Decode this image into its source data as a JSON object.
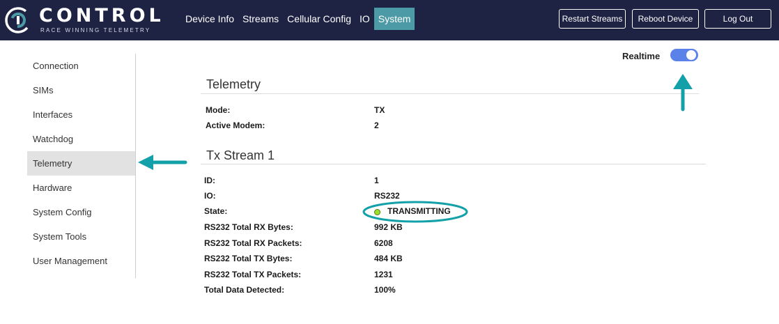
{
  "brand": {
    "name": "CONTROL",
    "tagline": "RACE WINNING TELEMETRY"
  },
  "nav": [
    {
      "label": "Device Info"
    },
    {
      "label": "Streams"
    },
    {
      "label": "Cellular Config"
    },
    {
      "label": "IO"
    },
    {
      "label": "System",
      "active": true
    }
  ],
  "actions": {
    "restart": "Restart Streams",
    "reboot": "Reboot Device",
    "logout": "Log Out"
  },
  "sidebar": {
    "items": [
      {
        "label": "Connection"
      },
      {
        "label": "SIMs"
      },
      {
        "label": "Interfaces"
      },
      {
        "label": "Watchdog"
      },
      {
        "label": "Telemetry",
        "active": true
      },
      {
        "label": "Hardware"
      },
      {
        "label": "System Config"
      },
      {
        "label": "System Tools"
      },
      {
        "label": "User Management"
      }
    ]
  },
  "realtime": {
    "label": "Realtime",
    "enabled": true
  },
  "telemetry": {
    "title": "Telemetry",
    "rows": [
      {
        "label": "Mode:",
        "value": "TX"
      },
      {
        "label": "Active Modem:",
        "value": "2"
      }
    ]
  },
  "tx_stream": {
    "title": "Tx Stream 1",
    "rows": [
      {
        "label": "ID:",
        "value": "1"
      },
      {
        "label": "IO:",
        "value": "RS232"
      },
      {
        "label": "State:",
        "value": "TRANSMITTING"
      },
      {
        "label": "RS232 Total RX Bytes:",
        "value": "992 KB"
      },
      {
        "label": "RS232 Total RX Packets:",
        "value": "6208"
      },
      {
        "label": "RS232 Total TX Bytes:",
        "value": "484 KB"
      },
      {
        "label": "RS232 Total TX Packets:",
        "value": "1231"
      },
      {
        "label": "Total Data Detected:",
        "value": "100%"
      }
    ]
  },
  "colors": {
    "header": "#1e2344",
    "accent": "#4b9aa6",
    "toggle": "#5b82e8",
    "status_ok": "#9be02a",
    "annotation": "#13a0a8"
  }
}
